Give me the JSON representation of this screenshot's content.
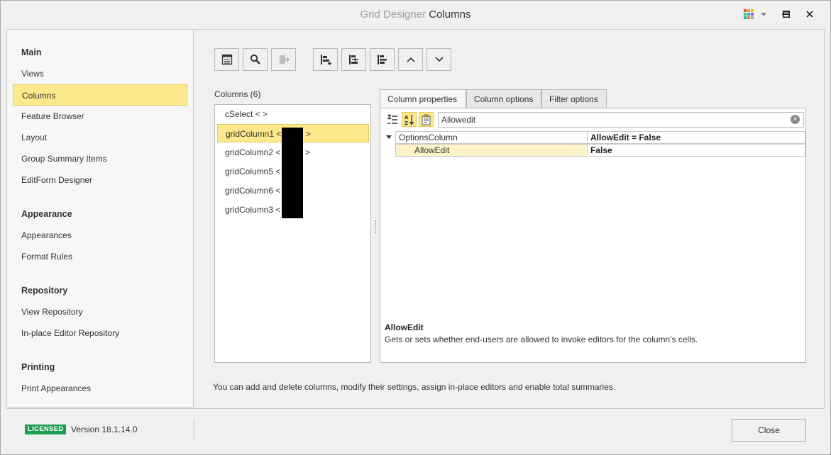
{
  "window": {
    "title_prefix": "Grid Designer",
    "title_main": "Columns"
  },
  "sidebar": {
    "groups": [
      {
        "label": "Main",
        "items": [
          "Views",
          "Columns",
          "Feature Browser",
          "Layout",
          "Group Summary Items",
          "EditForm Designer"
        ]
      },
      {
        "label": "Appearance",
        "items": [
          "Appearances",
          "Format Rules"
        ]
      },
      {
        "label": "Repository",
        "items": [
          "View Repository",
          "In-place Editor Repository"
        ]
      },
      {
        "label": "Printing",
        "items": [
          "Print Appearances"
        ]
      }
    ],
    "selected": "Columns"
  },
  "toolbar": {
    "buttons": [
      "retrieve-fields-icon",
      "show-field-list-icon",
      "remove-icon",
      "add-column-icon",
      "insert-column-icon",
      "delete-column-icon",
      "move-up-icon",
      "move-down-icon"
    ]
  },
  "columns": {
    "label": "Columns (6)",
    "items": [
      {
        "name": "cSelect < >"
      },
      {
        "name": "gridColumn1 <"
      },
      {
        "name": "gridColumn2 <"
      },
      {
        "name": "gridColumn5 <"
      },
      {
        "name": "gridColumn6 <"
      },
      {
        "name": "gridColumn3 <"
      }
    ],
    "selected_index": 1
  },
  "tabs": [
    "Column properties",
    "Column options",
    "Filter options"
  ],
  "active_tab": "Column properties",
  "property_grid": {
    "search_value": "Allowedit",
    "rows": [
      {
        "name": "OptionsColumn",
        "value": "AllowEdit = False",
        "expandable": true
      },
      {
        "name": "AllowEdit",
        "value": "False",
        "selected": true
      }
    ],
    "description_title": "AllowEdit",
    "description_text": "Gets or sets whether end-users are allowed to invoke editors for the column's cells."
  },
  "hint": "You can add and delete columns, modify their settings, assign in-place editors and enable total summaries.",
  "footer": {
    "badge": "LICENSED",
    "version": "Version 18.1.14.0",
    "close_label": "Close"
  },
  "colors": {
    "selection": "#fde98c",
    "licensed": "#1e9e52"
  }
}
